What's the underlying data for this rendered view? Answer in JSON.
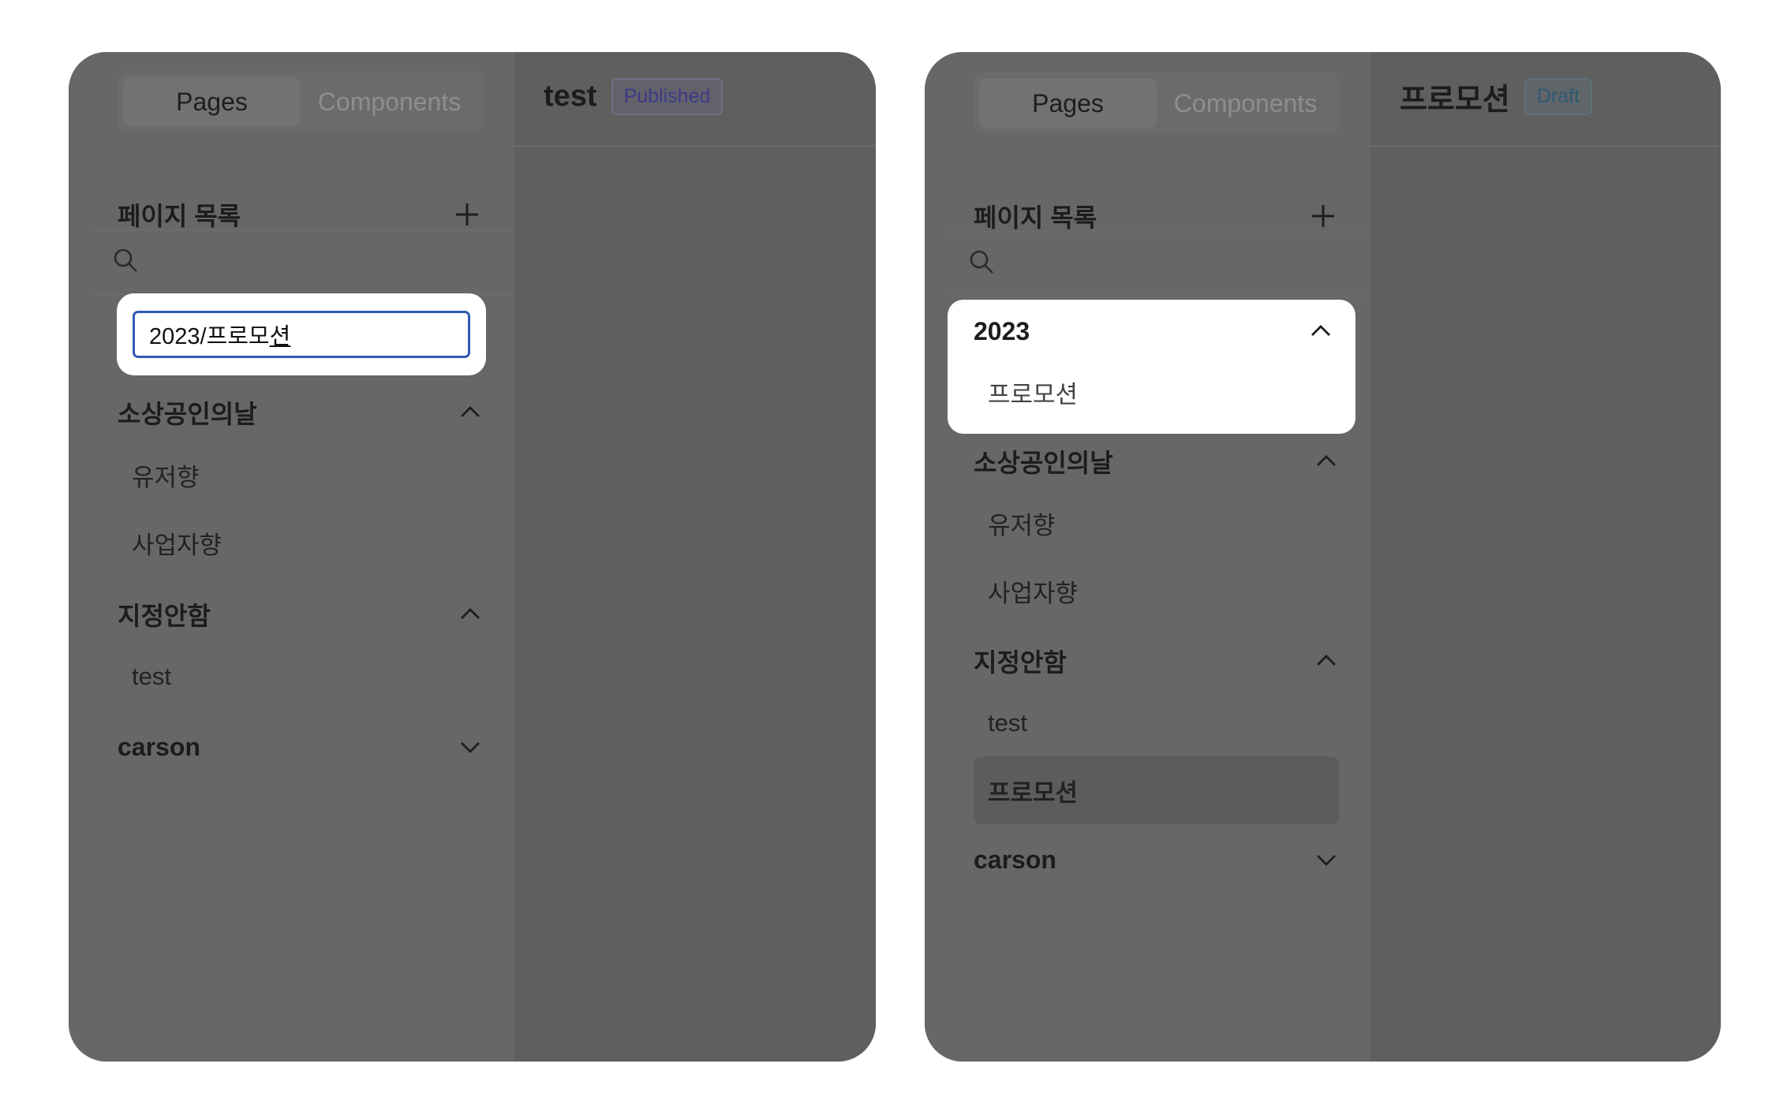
{
  "left_panel": {
    "tabs": [
      {
        "label": "Pages",
        "active": true
      },
      {
        "label": "Components",
        "active": false
      }
    ],
    "section_title": "페이지 목록",
    "rename_input": {
      "value_main": "2023/프로모",
      "value_composing": "션"
    },
    "groups": [
      {
        "title": "소상공인의날",
        "expanded": true,
        "items": [
          "유저향",
          "사업자향"
        ]
      },
      {
        "title": "지정안함",
        "expanded": true,
        "items": [
          "test"
        ]
      },
      {
        "title": "carson",
        "expanded": false,
        "items": []
      }
    ],
    "page": {
      "title": "test",
      "status": "Published"
    }
  },
  "right_panel": {
    "tabs": [
      {
        "label": "Pages",
        "active": true
      },
      {
        "label": "Components",
        "active": false
      }
    ],
    "section_title": "페이지 목록",
    "new_group": {
      "title": "2023",
      "expanded": true,
      "items": [
        "프로모션"
      ]
    },
    "groups": [
      {
        "title": "소상공인의날",
        "expanded": true,
        "items": [
          "유저향",
          "사업자향"
        ]
      },
      {
        "title": "지정안함",
        "expanded": true,
        "items": [
          "test",
          "프로모션"
        ],
        "selected_item": "프로모션"
      },
      {
        "title": "carson",
        "expanded": false,
        "items": []
      }
    ],
    "page": {
      "title": "프로모션",
      "status": "Draft"
    }
  },
  "colors": {
    "input_focus_border": "#2f5bb5",
    "published_badge_text": "#3e3a86",
    "draft_badge_text": "#2e5a73"
  },
  "icons": [
    "plus-icon",
    "search-icon",
    "chevron-up-icon",
    "chevron-down-icon"
  ]
}
